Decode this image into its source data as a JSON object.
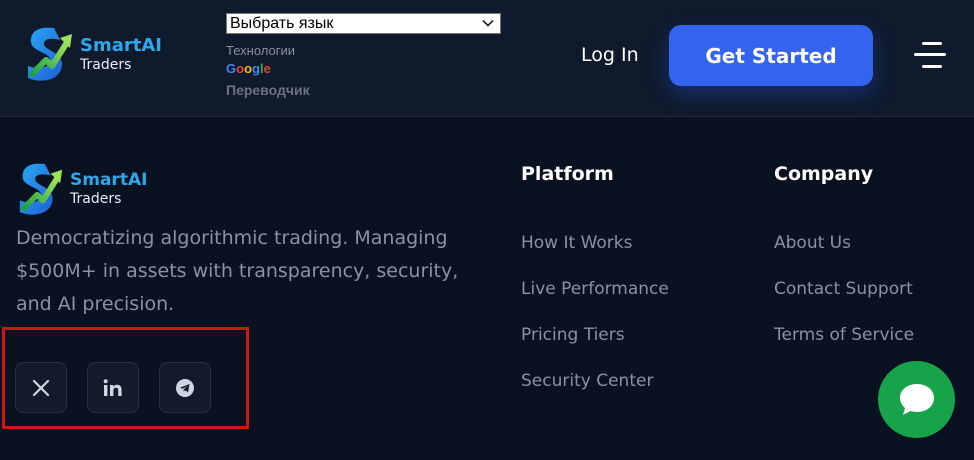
{
  "header": {
    "logo": {
      "name": "SmartAI",
      "sub": "Traders"
    },
    "language_select": {
      "value": "Выбрать язык"
    },
    "translate_badge": {
      "tech": "Технологии",
      "google": [
        "G",
        "o",
        "o",
        "g",
        "l",
        "e"
      ],
      "translator": "Переводчик"
    },
    "login_label": "Log In",
    "cta_label": "Get Started"
  },
  "footer": {
    "logo": {
      "name": "SmartAI",
      "sub": "Traders"
    },
    "tagline": "Democratizing algorithmic trading. Managing $500M+ in assets with transparency, security, and AI precision.",
    "social": [
      {
        "icon": "x-icon"
      },
      {
        "icon": "linkedin-icon"
      },
      {
        "icon": "telegram-icon"
      }
    ],
    "platform": {
      "title": "Platform",
      "links": [
        "How It Works",
        "Live Performance",
        "Pricing Tiers",
        "Security Center"
      ]
    },
    "company": {
      "title": "Company",
      "links": [
        "About Us",
        "Contact Support",
        "Terms of Service"
      ]
    }
  },
  "colors": {
    "background": "#0a1120",
    "header_bg": "#0f1a2c",
    "accent": "#3464ef",
    "logo_blue": "#2ea8ea",
    "muted_text": "#8a93a3",
    "chat_green": "#16a34a",
    "highlight_red": "#d11414"
  }
}
